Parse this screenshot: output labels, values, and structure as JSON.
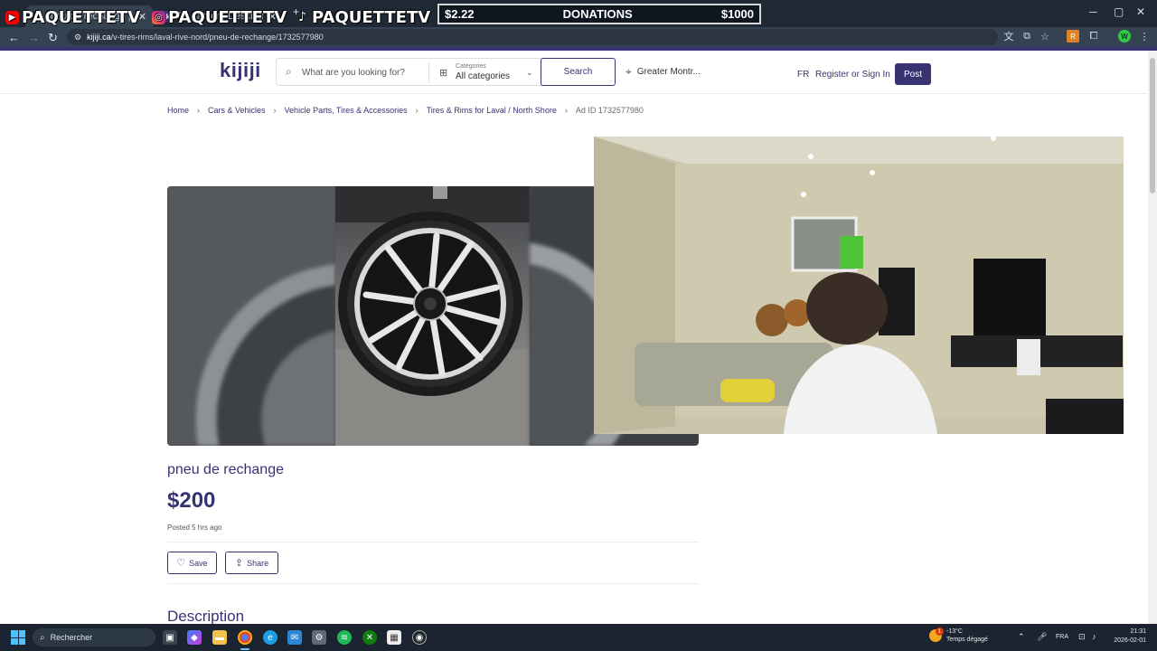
{
  "browser": {
    "tabs": [
      {
        "label": "pneu de rechange | Tires & Ri",
        "favicon": "k"
      },
      {
        "label": "Pc gamer | Desktop Compute",
        "favicon": "k"
      }
    ],
    "url_host": "kijiji.ca",
    "url_path": "/v-tires-rims/laval-rive-nord/pneu-de-rechange/1732577980"
  },
  "overlay": {
    "socials": [
      {
        "platform": "youtube",
        "handle": "PAQUETTETV"
      },
      {
        "platform": "instagram",
        "handle": "PAQUETTETV"
      },
      {
        "platform": "tiktok",
        "handle": "PAQUETTETV"
      }
    ],
    "donation": {
      "current": "$2.22",
      "label": "DONATIONS",
      "goal": "$1000"
    }
  },
  "header": {
    "logo": "kijiji",
    "search_placeholder": "What are you looking for?",
    "categories_label": "Categories",
    "categories_value": "All categories",
    "search_button": "Search",
    "location": "Greater Montr...",
    "lang": "FR",
    "register_text": "Register or Sign In",
    "post_button": "Post"
  },
  "breadcrumb": {
    "items": [
      "Home",
      "Cars & Vehicles",
      "Vehicle Parts, Tires & Accessories",
      "Tires & Rims for Laval / North Shore"
    ],
    "ad_id": "Ad ID 1732577980"
  },
  "listing": {
    "title": "pneu de rechange",
    "price": "$200",
    "posted": "Posted 5 hrs ago",
    "save_label": "Save",
    "share_label": "Share",
    "description_heading": "Description"
  },
  "taskbar": {
    "search_placeholder": "Rechercher",
    "weather_temp": "-13°C",
    "weather_desc": "Temps dégagé",
    "weather_badge": "1",
    "language": "FRA",
    "time": "21:31",
    "date": "2026-02-01"
  },
  "colors": {
    "brand": "#373373",
    "brand_accent": "#f8aa17",
    "tab_bar": "#1f2a36",
    "taskbar": "#1b2430"
  }
}
